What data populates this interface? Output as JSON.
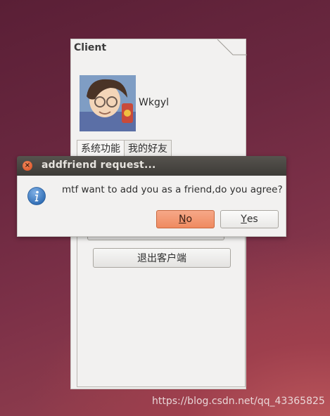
{
  "client_window": {
    "title": "Client",
    "username": "Wkgyl",
    "tabs": [
      {
        "label": "系统功能",
        "active": true
      },
      {
        "label": "我的好友",
        "active": false
      }
    ],
    "combo_value": "",
    "quit_button_label": "退出客户端"
  },
  "dialog": {
    "title": "addfriend request...",
    "message": "mtf want to add you as a friend,do you agree?",
    "no_button": {
      "mnemonic": "N",
      "rest": "o"
    },
    "yes_button": {
      "mnemonic": "Y",
      "rest": "es"
    },
    "icon": "info-icon",
    "close_icon": "close-icon"
  },
  "watermark": "https://blog.csdn.net/qq_43365825",
  "colors": {
    "default_button": "#ef8a60",
    "titlebar": "#3d3b37",
    "close_button": "#d84b1f",
    "window_bg": "#f2f1f0"
  }
}
